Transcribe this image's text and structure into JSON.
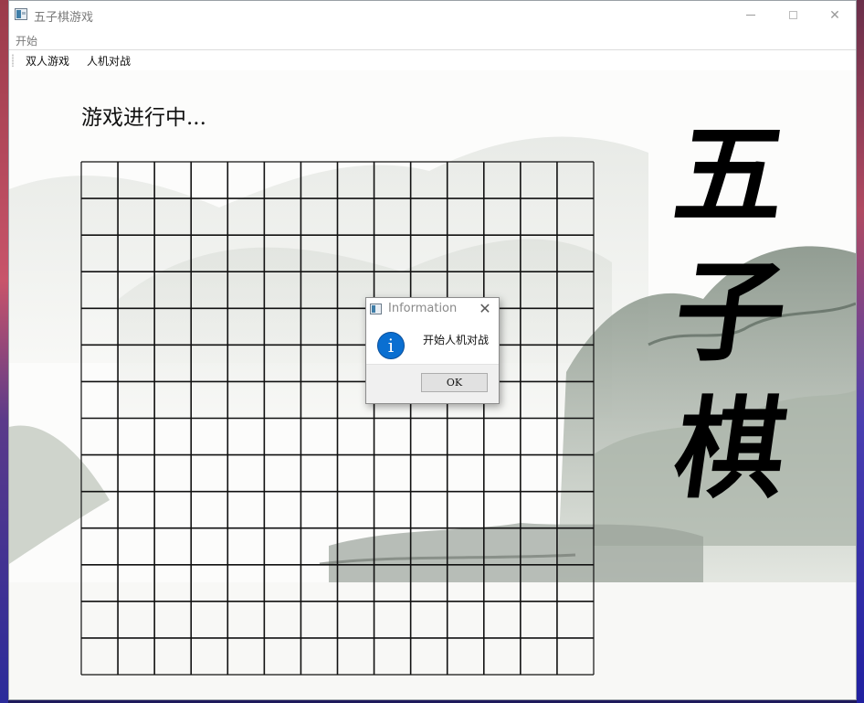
{
  "window": {
    "title": "五子棋游戏",
    "controls": {
      "minimize": "",
      "maximize": "",
      "close": "✕"
    }
  },
  "menubar": {
    "items": [
      {
        "label": "开始"
      }
    ]
  },
  "toolbar": {
    "buttons": [
      {
        "label": "双人游戏"
      },
      {
        "label": "人机对战"
      }
    ]
  },
  "game": {
    "status_text": "游戏进行中...",
    "board": {
      "rows": 14,
      "cols": 14,
      "line_color": "#111111"
    }
  },
  "calligraphy": {
    "chars": [
      "五",
      "子",
      "棋"
    ]
  },
  "dialog": {
    "title": "Information",
    "close_label": "✕",
    "icon": "information-icon",
    "message": "开始人机对战",
    "ok_label": "OK",
    "icon_color": "#0a6fd1"
  }
}
